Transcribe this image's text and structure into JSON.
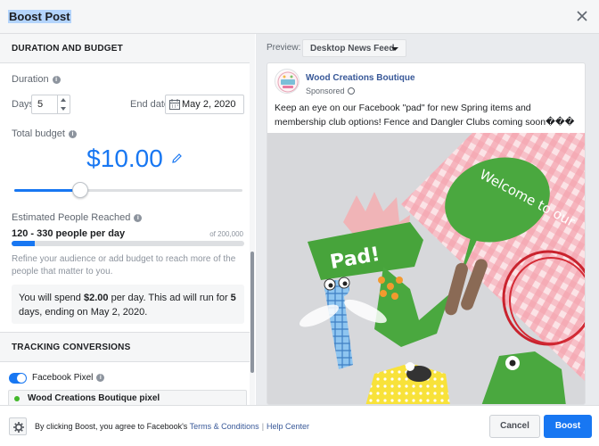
{
  "dialog": {
    "title": "Boost Post"
  },
  "duration_budget": {
    "section_title": "DURATION AND BUDGET",
    "duration_label": "Duration",
    "days_label": "Days",
    "days_value": "5",
    "end_date_label": "End date",
    "end_date_value": "May 2, 2020",
    "total_budget_label": "Total budget",
    "budget_value": "$10.00",
    "budget_slider_level": 0.29
  },
  "reach": {
    "label": "Estimated People Reached",
    "range_text": "120 - 330 people per day",
    "max_text": "of 200,000",
    "bar_level": 0.1,
    "hint": "Refine your audience or add budget to reach more of the people that matter to you."
  },
  "spend": {
    "part1": "You will spend ",
    "amount": "$2.00",
    "part2": " per day. This ad will run for ",
    "days": "5",
    "part3": " days, ending on May 2, 2020."
  },
  "tracking": {
    "section_title": "TRACKING CONVERSIONS",
    "pixel_label": "Facebook Pixel",
    "pixel_enabled": true,
    "pixel_name": "Wood Creations Boutique pixel"
  },
  "preview": {
    "label": "Preview:",
    "selected": "Desktop News Feed"
  },
  "post": {
    "page_name": "Wood Creations Boutique",
    "sponsored": "Sponsored",
    "text": "Keep an eye on our Facebook \"pad\" for new Spring items and membership club options! Fence and Dangler Clubs coming soon���",
    "image_sign_pad": "Pad!",
    "image_sign_welcome": "Welcome to our"
  },
  "footer": {
    "agree_text": "By clicking Boost, you agree to Facebook's ",
    "terms_link": "Terms & Conditions",
    "separator": "|",
    "help_link": "Help Center",
    "cancel_label": "Cancel",
    "boost_label": "Boost"
  },
  "colors": {
    "accent": "#1877f2",
    "link": "#385898",
    "pixel_status": "#42b72a"
  }
}
